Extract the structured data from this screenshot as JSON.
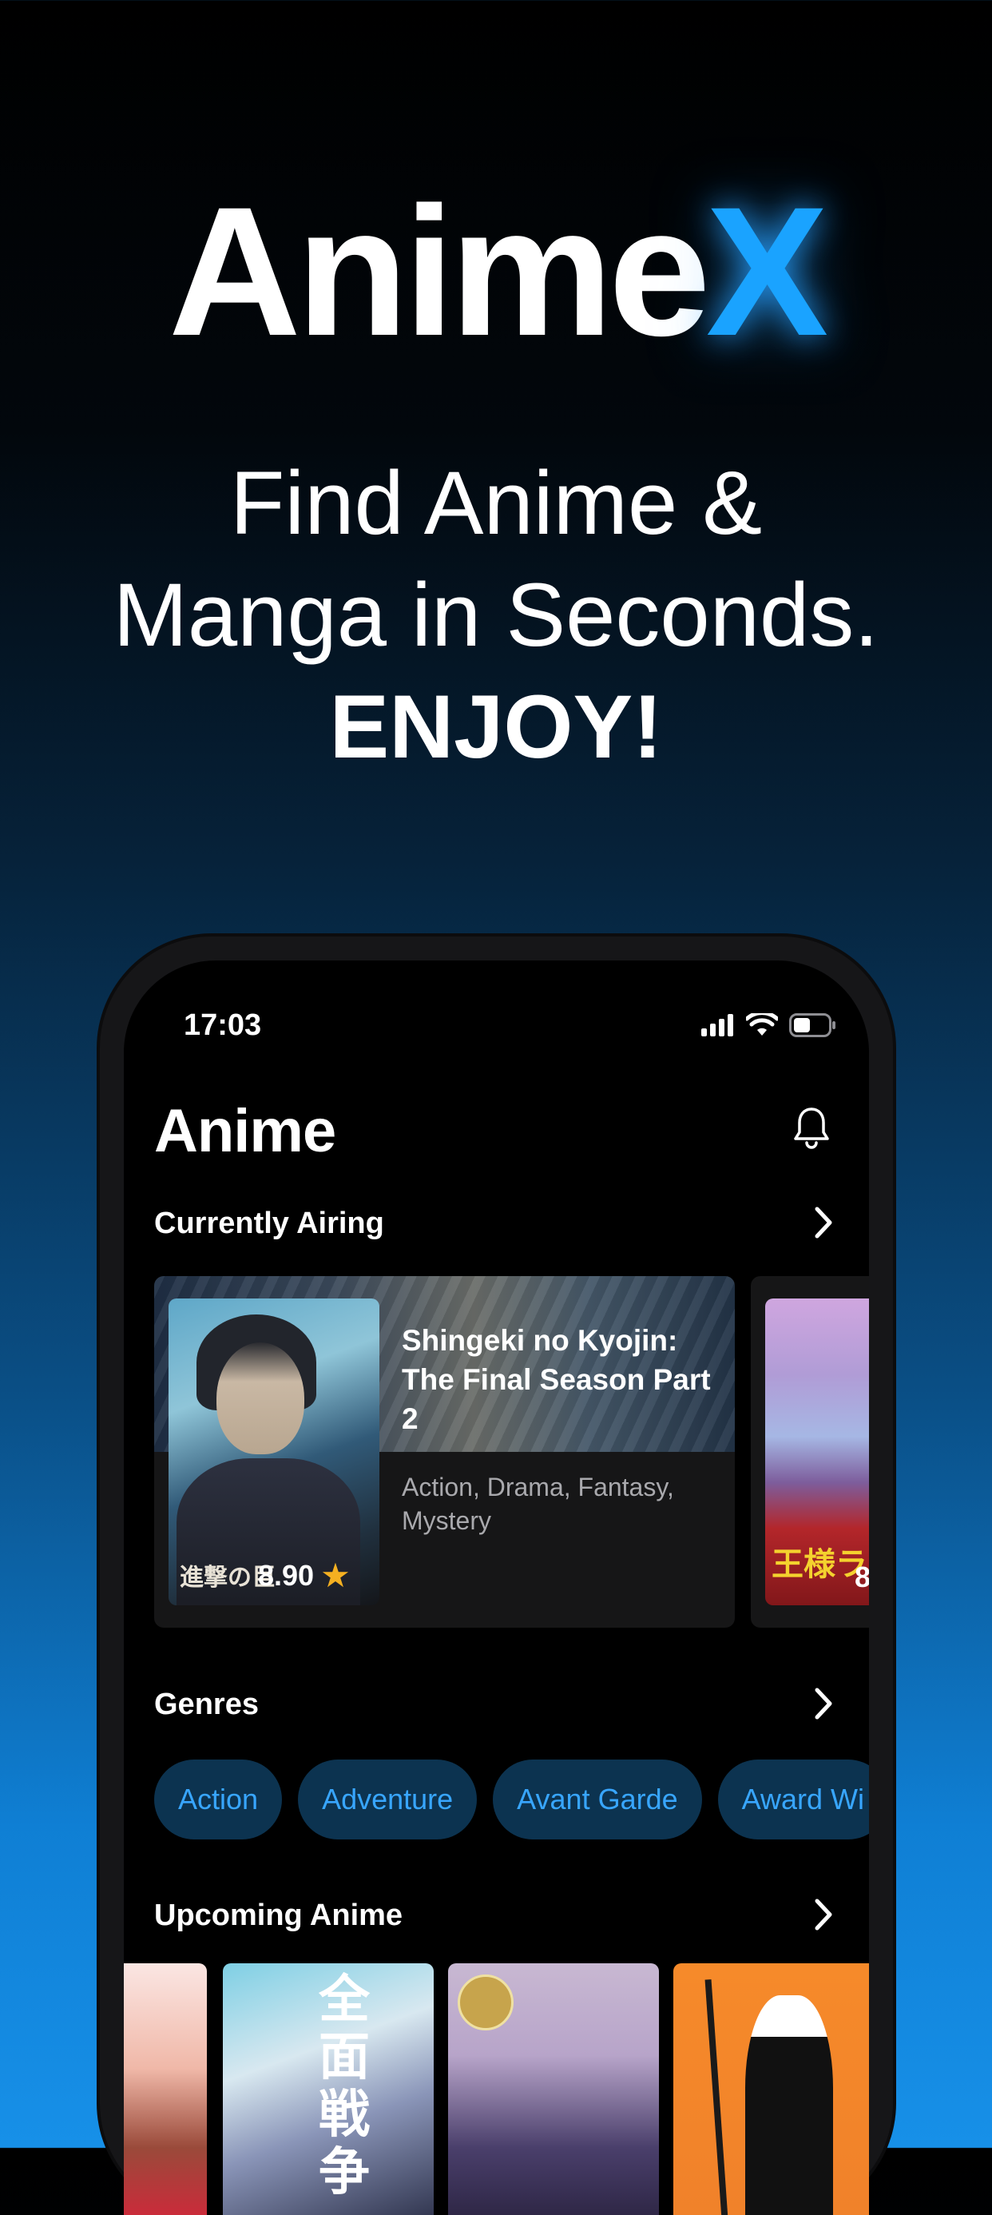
{
  "promo": {
    "logo_main": "Anime",
    "logo_accent": "X",
    "tagline_line1": "Find Anime &",
    "tagline_line2": "Manga in Seconds.",
    "tagline_emphasis": "ENJOY!",
    "accent_color": "#1aa3ff"
  },
  "status_bar": {
    "time": "17:03",
    "icons": [
      "signal-icon",
      "wifi-icon",
      "battery-icon"
    ]
  },
  "app": {
    "title": "Anime",
    "notification_icon": "bell-icon"
  },
  "currently_airing": {
    "heading": "Currently Airing",
    "items": [
      {
        "title": "Shingeki no Kyojin: The Final Season Part 2",
        "genres": "Action, Drama, Fantasy, Mystery",
        "score": "8.90",
        "poster_text": "進撃の巨"
      },
      {
        "poster_text": "王様ラ",
        "score": "8"
      }
    ]
  },
  "genres": {
    "heading": "Genres",
    "chips": [
      "Action",
      "Adventure",
      "Avant Garde",
      "Award Wi"
    ]
  },
  "upcoming": {
    "heading": "Upcoming Anime",
    "posters": [
      {
        "text": ""
      },
      {
        "text": "全面戦争"
      },
      {
        "text": ""
      },
      {
        "text": ""
      }
    ]
  }
}
